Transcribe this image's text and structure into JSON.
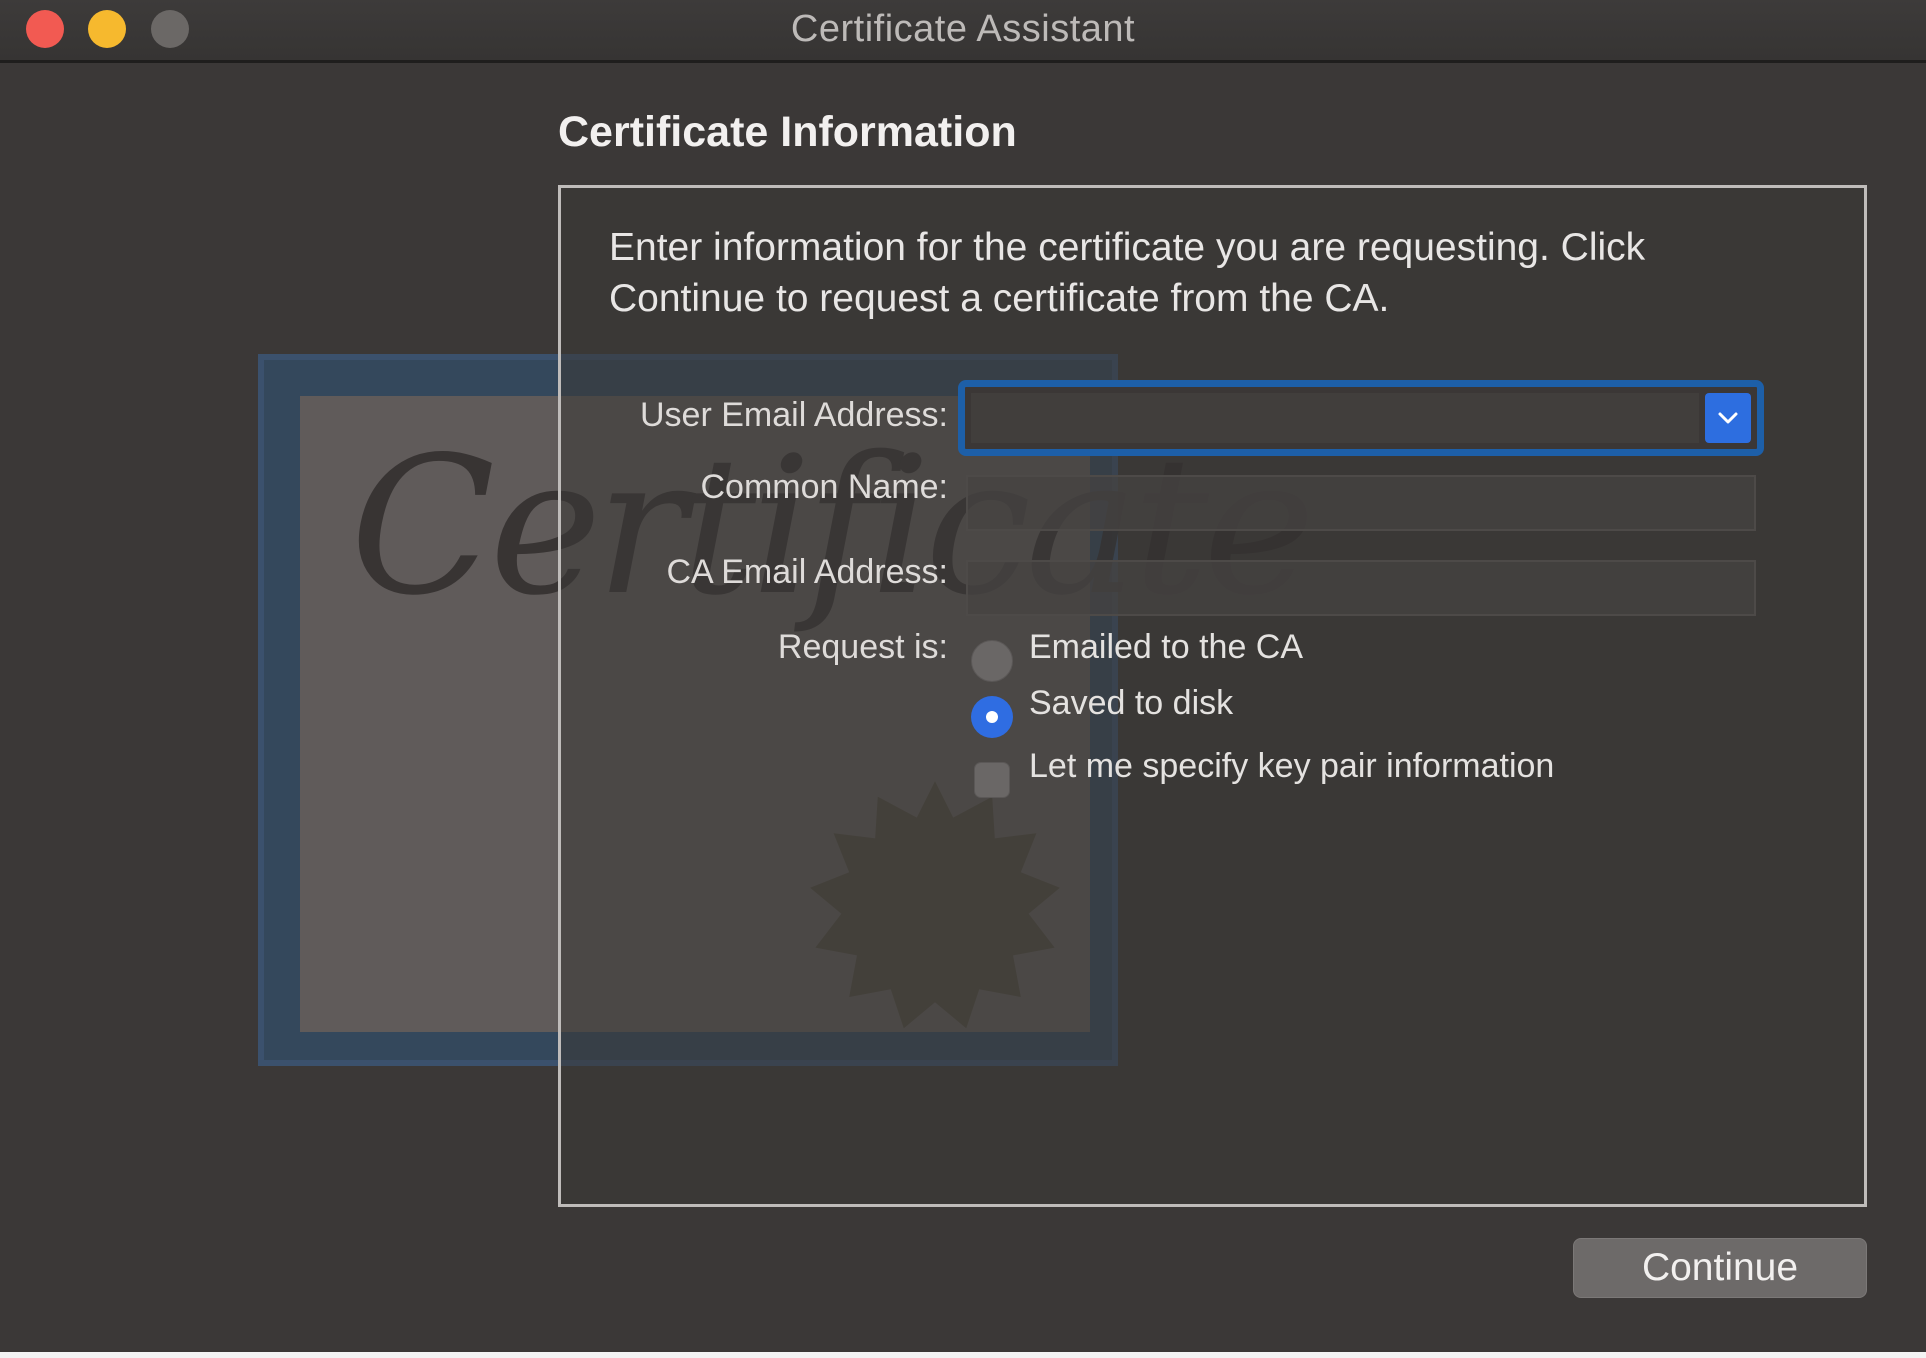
{
  "window": {
    "title": "Certificate Assistant"
  },
  "content": {
    "section_title": "Certificate Information",
    "intro_text": "Enter information for the certificate you are requesting. Click Continue to request a certificate from the CA."
  },
  "form": {
    "user_email": {
      "label": "User Email Address:",
      "value": ""
    },
    "common_name": {
      "label": "Common Name:",
      "value": ""
    },
    "ca_email": {
      "label": "CA Email Address:",
      "value": ""
    },
    "request_is": {
      "label": "Request is:",
      "options": [
        {
          "label": "Emailed to the CA",
          "selected": false
        },
        {
          "label": "Saved to disk",
          "selected": true
        }
      ]
    },
    "key_pair_checkbox": {
      "label": "Let me specify key pair information",
      "checked": false
    }
  },
  "buttons": {
    "continue_label": "Continue"
  },
  "artwork": {
    "certificate_script": "Certificate"
  },
  "colors": {
    "accent": "#2f6de2",
    "focus_ring": "#1d5fa8",
    "window_bg": "#3b3837",
    "close": "#f25a52",
    "minimize": "#f6b92e",
    "zoom_inactive": "#6b6866"
  }
}
